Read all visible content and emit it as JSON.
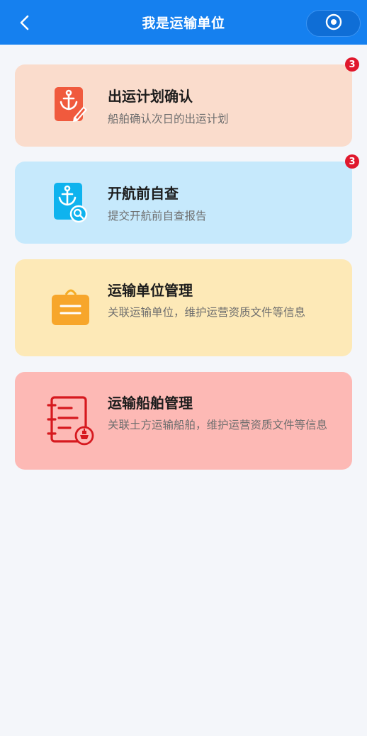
{
  "header": {
    "title": "我是运输单位",
    "back_icon": "chevron-left-icon",
    "capsule_icon": "target-circle-icon"
  },
  "colors": {
    "header_bg": "#1580ef",
    "badge": "#e0182d",
    "page_bg": "#f4f6fa"
  },
  "cards": [
    {
      "title": "出运计划确认",
      "desc": "船舶确认次日的出运计划",
      "badge": "3",
      "icon": "anchor-edit-icon",
      "bg": "#fadccc"
    },
    {
      "title": "开航前自查",
      "desc": "提交开航前自查报告",
      "badge": "3",
      "icon": "anchor-search-icon",
      "bg": "#c6e9fc"
    },
    {
      "title": "运输单位管理",
      "desc": "关联运输单位，维护运营资质文件等信息",
      "icon": "briefcase-icon",
      "bg": "#fde9b7"
    },
    {
      "title": "运输船舶管理",
      "desc": "关联土方运输船舶，维护运营资质文件等信息",
      "icon": "ship-document-icon",
      "bg": "#fdb9b5"
    }
  ]
}
